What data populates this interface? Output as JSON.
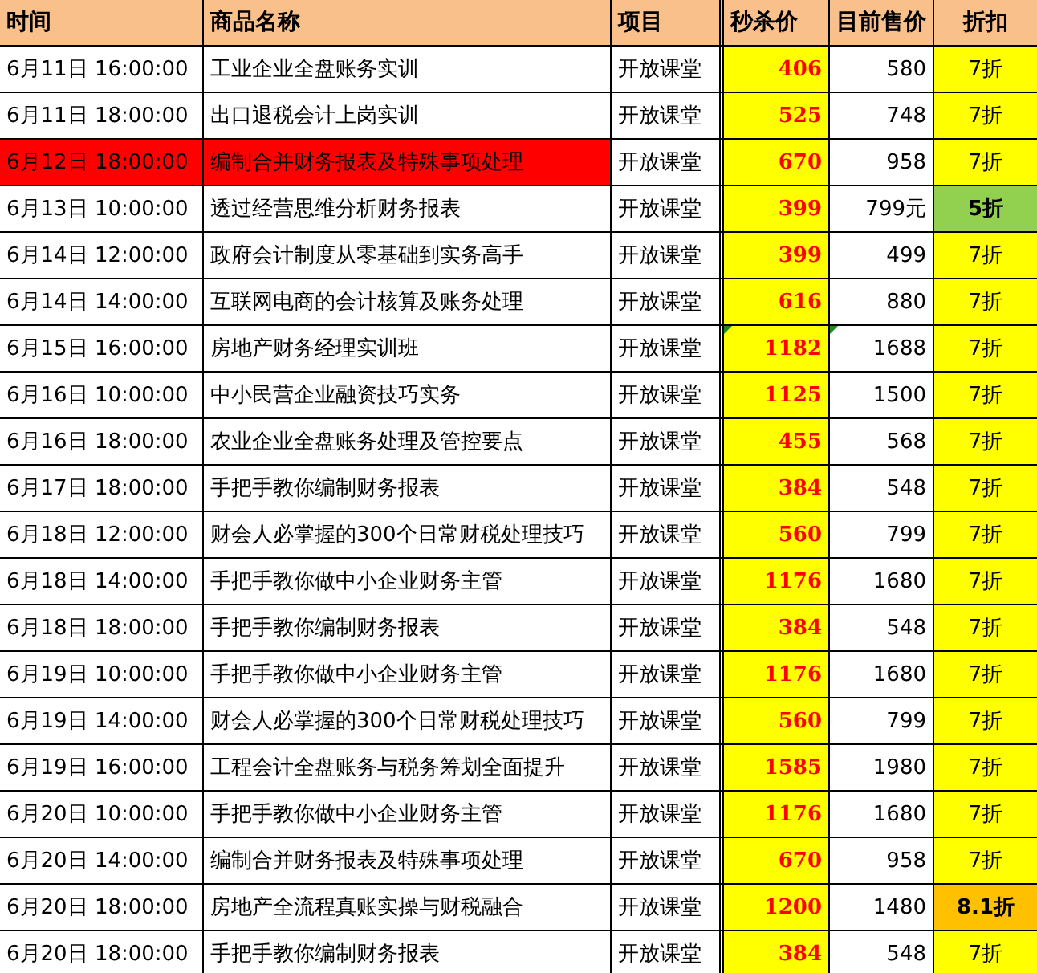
{
  "table": {
    "columns": [
      "时间",
      "商品名称",
      "项目",
      "秒杀价",
      "目前售价",
      "折扣"
    ],
    "rows": [
      {
        "time": "6月11日  16:00:00",
        "name": "工业企业全盘账务实训",
        "project": "开放课堂",
        "flash_price": "406",
        "price": "580",
        "discount": "7折",
        "highlighted": false,
        "flagged": false,
        "color": "#ffff00",
        "bold": false
      },
      {
        "time": "6月11日  18:00:00",
        "name": "出口退税会计上岗实训",
        "project": "开放课堂",
        "flash_price": "525",
        "price": "748",
        "discount": "7折",
        "highlighted": false,
        "flagged": false,
        "color": "#ffff00",
        "bold": false
      },
      {
        "time": "6月12日  18:00:00",
        "name": "编制合并财务报表及特殊事项处理",
        "project": "开放课堂",
        "flash_price": "670",
        "price": "958",
        "discount": "7折",
        "highlighted": true,
        "flagged": false,
        "color": "#ffff00",
        "bold": false
      },
      {
        "time": "6月13日  10:00:00",
        "name": "透过经营思维分析财务报表",
        "project": "开放课堂",
        "flash_price": "399",
        "price": "799元",
        "discount": "5折",
        "highlighted": false,
        "flagged": false,
        "color": "#92d050",
        "bold": true
      },
      {
        "time": "6月14日  12:00:00",
        "name": "政府会计制度从零基础到实务高手",
        "project": "开放课堂",
        "flash_price": "399",
        "price": "499",
        "discount": "7折",
        "highlighted": false,
        "flagged": false,
        "color": "#ffff00",
        "bold": false
      },
      {
        "time": "6月14日  14:00:00",
        "name": "互联网电商的会计核算及账务处理",
        "project": "开放课堂",
        "flash_price": "616",
        "price": "880",
        "discount": "7折",
        "highlighted": false,
        "flagged": false,
        "color": "#ffff00",
        "bold": false
      },
      {
        "time": "6月15日  16:00:00",
        "name": "房地产财务经理实训班",
        "project": "开放课堂",
        "flash_price": "1182",
        "price": "1688",
        "discount": "7折",
        "highlighted": false,
        "flagged": true,
        "color": "#ffff00",
        "bold": false
      },
      {
        "time": "6月16日  10:00:00",
        "name": "中小民营企业融资技巧实务",
        "project": "开放课堂",
        "flash_price": "1125",
        "price": "1500",
        "discount": "7折",
        "highlighted": false,
        "flagged": false,
        "color": "#ffff00",
        "bold": false
      },
      {
        "time": "6月16日  18:00:00",
        "name": "农业企业全盘账务处理及管控要点",
        "project": "开放课堂",
        "flash_price": "455",
        "price": "568",
        "discount": "7折",
        "highlighted": false,
        "flagged": false,
        "color": "#ffff00",
        "bold": false
      },
      {
        "time": "6月17日  18:00:00",
        "name": "手把手教你编制财务报表",
        "project": "开放课堂",
        "flash_price": "384",
        "price": "548",
        "discount": "7折",
        "highlighted": false,
        "flagged": false,
        "color": "#ffff00",
        "bold": false
      },
      {
        "time": "6月18日  12:00:00",
        "name": "财会人必掌握的300个日常财税处理技巧",
        "project": "开放课堂",
        "flash_price": "560",
        "price": "799",
        "discount": "7折",
        "highlighted": false,
        "flagged": false,
        "color": "#ffff00",
        "bold": false
      },
      {
        "time": "6月18日  14:00:00",
        "name": "手把手教你做中小企业财务主管",
        "project": "开放课堂",
        "flash_price": "1176",
        "price": "1680",
        "discount": "7折",
        "highlighted": false,
        "flagged": false,
        "color": "#ffff00",
        "bold": false
      },
      {
        "time": "6月18日  18:00:00",
        "name": "手把手教你编制财务报表",
        "project": "开放课堂",
        "flash_price": "384",
        "price": "548",
        "discount": "7折",
        "highlighted": false,
        "flagged": false,
        "color": "#ffff00",
        "bold": false
      },
      {
        "time": "6月19日  10:00:00",
        "name": "手把手教你做中小企业财务主管",
        "project": "开放课堂",
        "flash_price": "1176",
        "price": "1680",
        "discount": "7折",
        "highlighted": false,
        "flagged": false,
        "color": "#ffff00",
        "bold": false
      },
      {
        "time": "6月19日  14:00:00",
        "name": "财会人必掌握的300个日常财税处理技巧",
        "project": "开放课堂",
        "flash_price": "560",
        "price": "799",
        "discount": "7折",
        "highlighted": false,
        "flagged": false,
        "color": "#ffff00",
        "bold": false
      },
      {
        "time": "6月19日  16:00:00",
        "name": "工程会计全盘账务与税务筹划全面提升",
        "project": "开放课堂",
        "flash_price": "1585",
        "price": "1980",
        "discount": "7折",
        "highlighted": false,
        "flagged": false,
        "color": "#ffff00",
        "bold": false
      },
      {
        "time": "6月20日  10:00:00",
        "name": "手把手教你做中小企业财务主管",
        "project": "开放课堂",
        "flash_price": "1176",
        "price": "1680",
        "discount": "7折",
        "highlighted": false,
        "flagged": false,
        "color": "#ffff00",
        "bold": false
      },
      {
        "time": "6月20日  14:00:00",
        "name": "编制合并财务报表及特殊事项处理",
        "project": "开放课堂",
        "flash_price": "670",
        "price": "958",
        "discount": "7折",
        "highlighted": false,
        "flagged": false,
        "color": "#ffff00",
        "bold": false
      },
      {
        "time": "6月20日  18:00:00",
        "name": "房地产全流程真账实操与财税融合",
        "project": "开放课堂",
        "flash_price": "1200",
        "price": "1480",
        "discount": "8.1折",
        "highlighted": false,
        "flagged": false,
        "color": "#ffc000",
        "bold": true
      },
      {
        "time": "6月20日  18:00:00",
        "name": "手把手教你编制财务报表",
        "project": "开放课堂",
        "flash_price": "384",
        "price": "548",
        "discount": "7折",
        "highlighted": false,
        "flagged": false,
        "color": "#ffff00",
        "bold": false
      }
    ]
  }
}
